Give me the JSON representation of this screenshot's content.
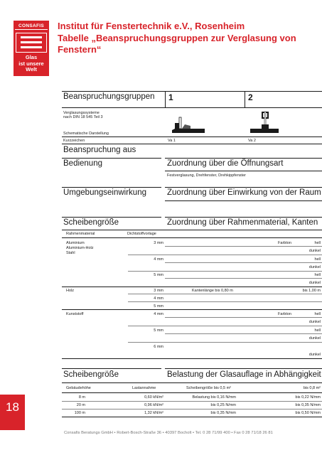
{
  "logo": {
    "brand": "CONSAFIS",
    "slogan_lines": [
      "Glas",
      "ist unsere",
      "Welt"
    ]
  },
  "header": {
    "line1": "Institut für Fenstertechnik e.V., Rosenheim",
    "line2": "Tabelle „Beanspruchungsgruppen zur Verglasung von",
    "line3": "Fenstern“"
  },
  "table1": {
    "heading": "Beanspruchungsgruppen",
    "col1": "1",
    "col2": "2",
    "verglasung_line1": "Verglasungssysteme",
    "verglasung_line2": "nach DIN 18 545 Teil 3",
    "schematische": "Schematische Darstellung",
    "kurzzeichen": "Kurzzeichen",
    "kz1": "Va 1",
    "kz2": "Va 2",
    "beanspruchung_aus": "Beanspruchung aus",
    "bedienung": "Bedienung",
    "zuordnung_oeffnung": "Zuordnung über die Öffnungsart",
    "oeffnung_detail": "Festverglasung, Drehfenster, Drehkippfenster",
    "umgebung": "Umgebungseinwirkung",
    "zuordnung_raum": "Zuordnung über Einwirkung von der Raum",
    "scheibengroesse": "Scheibengröße",
    "zuordnung_rahmen": "Zuordnung über Rahmenmaterial, Kanten",
    "rahmenmaterial": "Rahmenmaterial",
    "dichtstoffvorlage": "Dichtstoffvorlage",
    "mat_metal_1": "Aluminium",
    "mat_metal_2": "Aluminium-Holz",
    "mat_metal_3": "Stahl",
    "mat_holz": "Holz",
    "mat_kunststoff": "Kunststoff",
    "mm3": "3 mm",
    "mm4": "4 mm",
    "mm5": "5 mm",
    "mm6": "6 mm",
    "farbton": "Farbton",
    "hell": "hell",
    "dunkel": "dunkel",
    "kantenlaenge": "Kantenlänge bis 0,80 m",
    "bis100": "bis 1,00 m"
  },
  "table2": {
    "heading": "Scheibengröße",
    "right_heading": "Belastung der Glasauflage in Abhängigkeit",
    "col_gebaeude": "Gebäudehöhe",
    "col_lastannahme": "Lastannahme",
    "col_scheibe": "Scheibengröße bis 0,5 m²",
    "col_bis08": "bis 0,8 m²",
    "rows": [
      {
        "hoehe": "8 m",
        "last": "0,60 kN/m²",
        "s1": "Belastung bis 0,16 N/mm",
        "s2": "bis 0,22 N/mm"
      },
      {
        "hoehe": "20 m",
        "last": "0,96 kN/m²",
        "s1": "bis 0,25 N/mm",
        "s2": "bis 0,35 N/mm"
      },
      {
        "hoehe": "100 m",
        "last": "1,32 kN/m²",
        "s1": "bis 0,35 N/mm",
        "s2": "bis 0,50 N/mm"
      }
    ]
  },
  "page": {
    "number": "18"
  },
  "footer": "Consafis Beratungs GmbH • Robert-Bosch-Straße 36 • 40397 Bocholt • Tel. 0 28 71/99 400 • Fax 0 28 71/18 26 81",
  "colors": {
    "accent": "#d8232a",
    "text": "#1a1a1a"
  }
}
